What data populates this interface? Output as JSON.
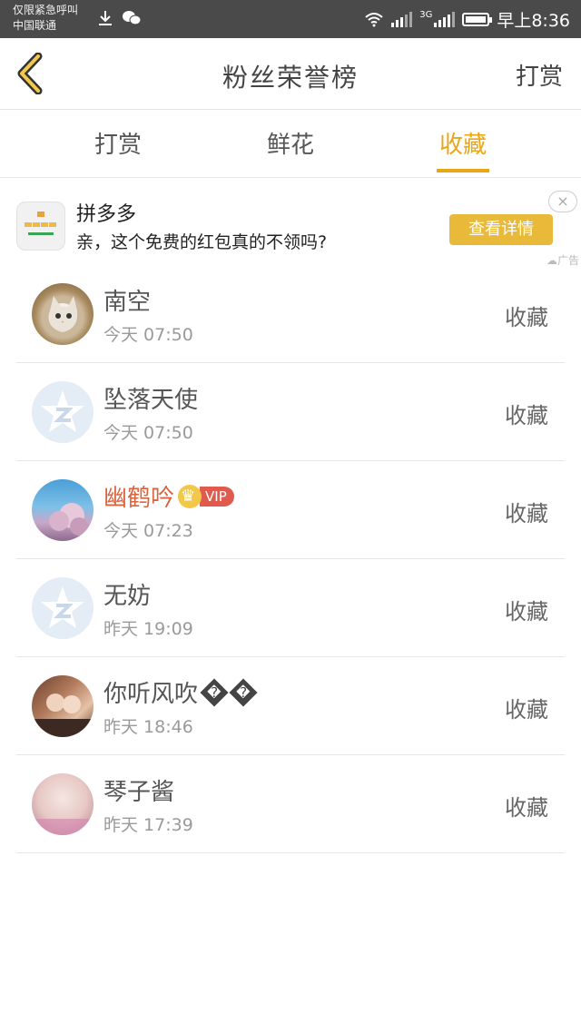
{
  "status_bar": {
    "carrier_line1": "仅限紧急呼叫",
    "carrier_line2": "中国联通",
    "network": "3G",
    "time": "早上8:36"
  },
  "header": {
    "title": "粉丝荣誉榜",
    "right_action": "打赏",
    "back_icon": "chevron-left-icon",
    "accent_color": "#e9a617"
  },
  "tabs": [
    {
      "label": "打赏",
      "active": false
    },
    {
      "label": "鲜花",
      "active": false
    },
    {
      "label": "收藏",
      "active": true
    }
  ],
  "ad": {
    "title": "拼多多",
    "description": "亲，这个免费的红包真的不领吗?",
    "button": "查看详情",
    "close": "×",
    "tag": "广告"
  },
  "list": [
    {
      "name": "南空",
      "time": "今天 07:50",
      "action": "收藏",
      "vip": false,
      "avatar": "cat"
    },
    {
      "name": "坠落天使",
      "time": "今天 07:50",
      "action": "收藏",
      "vip": false,
      "avatar": "default-q"
    },
    {
      "name": "幽鹤吟",
      "time": "今天 07:23",
      "action": "收藏",
      "vip": true,
      "vip_label": "VIP",
      "avatar": "blossom"
    },
    {
      "name": "无妨",
      "time": "昨天 19:09",
      "action": "收藏",
      "vip": false,
      "avatar": "default-q"
    },
    {
      "name": "你听风吹",
      "name_suffix": "�",
      "time": "昨天 18:46",
      "action": "收藏",
      "vip": false,
      "avatar": "couple"
    },
    {
      "name": "琴子酱",
      "time": "昨天 17:39",
      "action": "收藏",
      "vip": false,
      "avatar": "pink"
    }
  ]
}
